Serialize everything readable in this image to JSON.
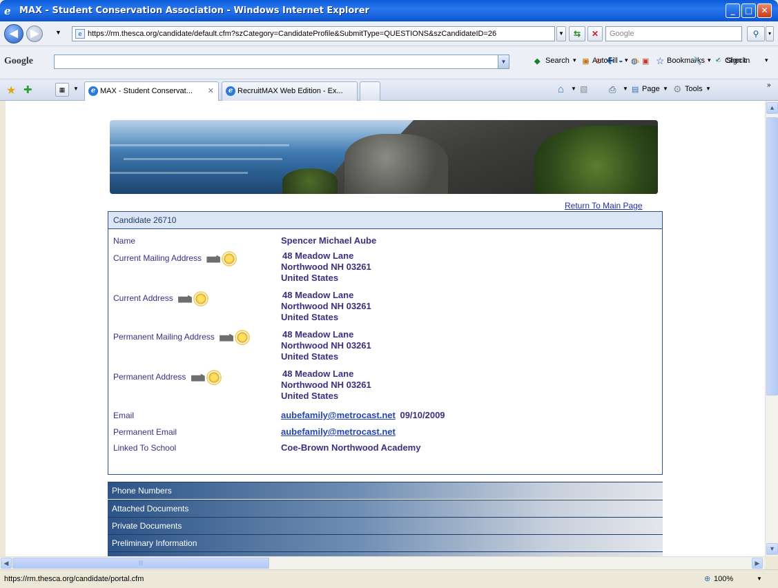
{
  "window": {
    "title": "MAX - Student Conservation Association - Windows Internet Explorer",
    "controls": [
      "minimize",
      "maximize",
      "close"
    ]
  },
  "address_bar": {
    "url": "https://rm.thesca.org/candidate/default.cfm?szCategory=CandidateProfile&SubmitType=QUESTIONS&szCandidateID=26",
    "search_placeholder": "Google"
  },
  "google_toolbar": {
    "logo": "Google",
    "search": "Search",
    "bookmarks": "Bookmarks",
    "check": "Check",
    "autofill": "AutoFill",
    "sign_in": "Sign In"
  },
  "tabs": [
    {
      "label": "MAX - Student Conservat...",
      "active": true
    },
    {
      "label": "RecruitMAX Web Edition - Ex...",
      "active": false
    }
  ],
  "command_bar": {
    "page": "Page",
    "tools": "Tools"
  },
  "page": {
    "return_link": "Return To Main Page",
    "panel_title": "Candidate 26710",
    "fields": {
      "name_label": "Name",
      "name_value": "Spencer Michael Aube",
      "current_mailing_label": "Current Mailing Address",
      "current_label": "Current Address",
      "permanent_mailing_label": "Permanent Mailing Address",
      "permanent_label": "Permanent Address",
      "addr_line1": "48 Meadow Lane",
      "addr_line2": "Northwood NH 03261",
      "addr_line3": "United States",
      "email_label": "Email",
      "email_value": "aubefamily@metrocast.net",
      "email_date": "09/10/2009",
      "perm_email_label": "Permanent Email",
      "perm_email_value": "aubefamily@metrocast.net",
      "school_label": "Linked To School",
      "school_value": "Coe-Brown Northwood Academy"
    },
    "sections": [
      "Phone Numbers",
      "Attached Documents",
      "Private Documents",
      "Preliminary Information"
    ]
  },
  "status_bar": {
    "url": "https://rm.thesca.org/candidate/portal.cfm",
    "zoom": "100%"
  }
}
